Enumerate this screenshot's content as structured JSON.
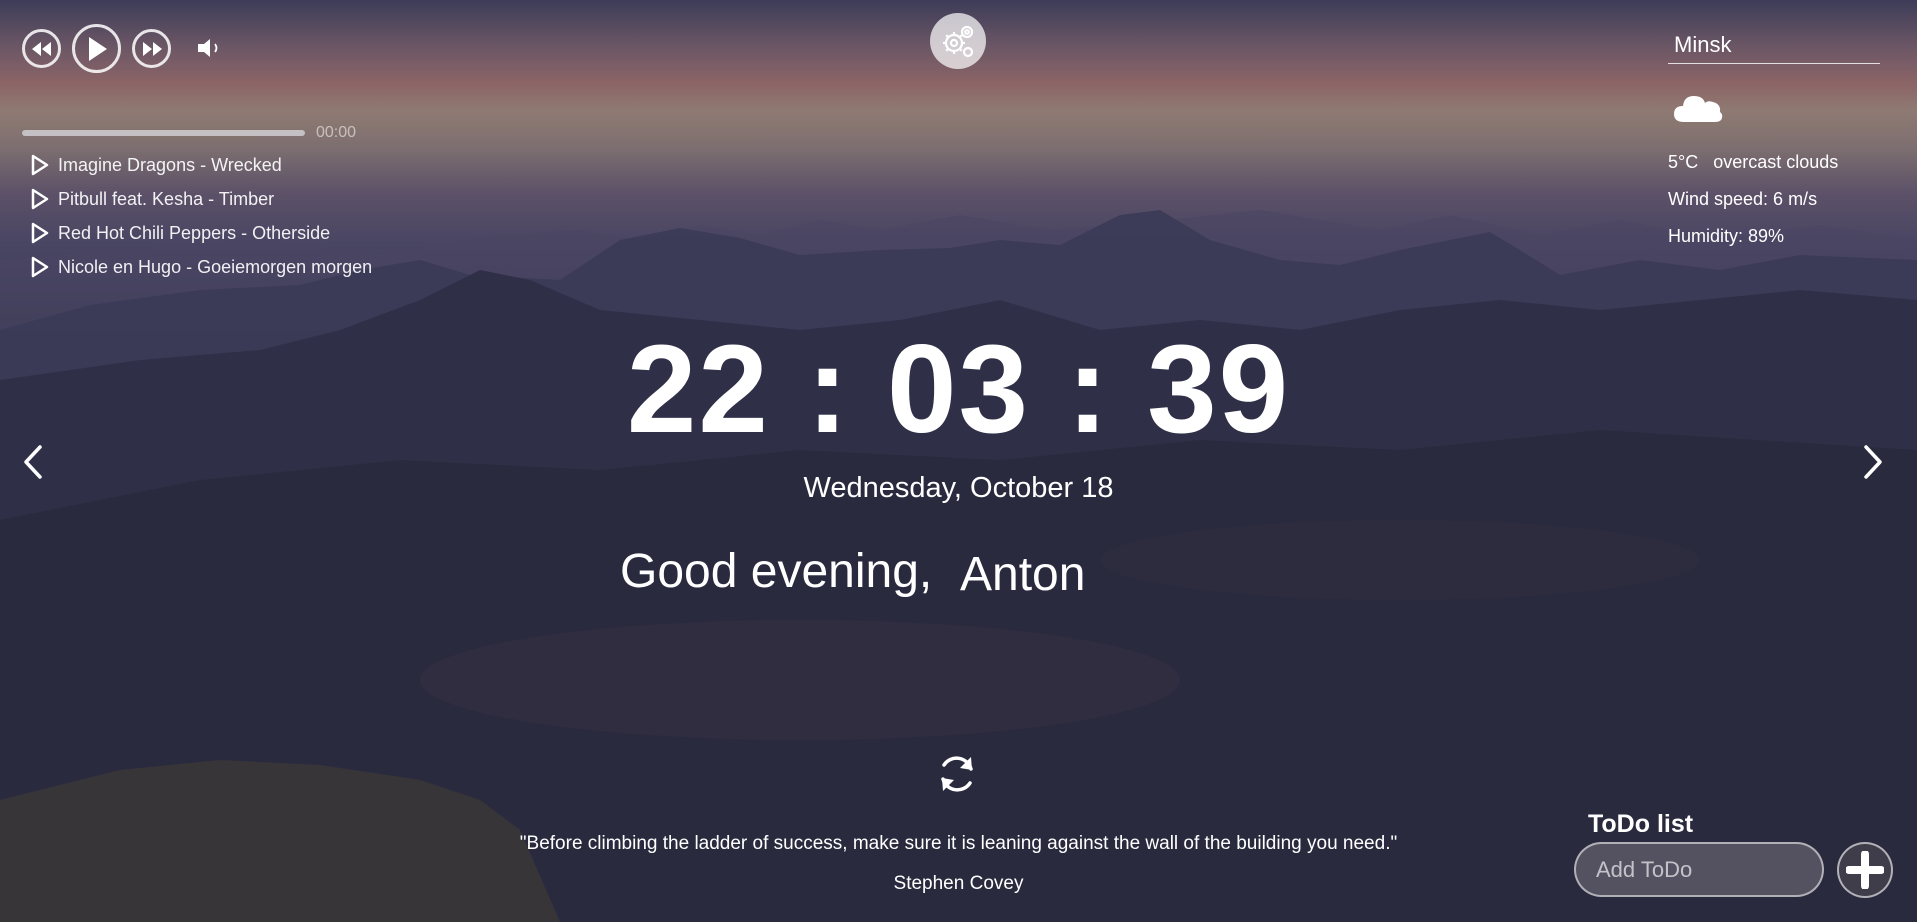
{
  "player": {
    "prev_icon": "rewind-icon",
    "play_icon": "play-icon",
    "next_icon": "fast-forward-icon",
    "volume_icon": "volume-icon",
    "current_time": "00:00",
    "progress_fraction": 0,
    "playlist": [
      {
        "title": "Imagine Dragons - Wrecked"
      },
      {
        "title": "Pitbull feat. Kesha - Timber"
      },
      {
        "title": "Red Hot Chili Peppers - Otherside"
      },
      {
        "title": "Nicole en Hugo - Goeiemorgen morgen"
      }
    ]
  },
  "settings": {
    "icon": "gears-icon"
  },
  "weather": {
    "city": "Minsk",
    "icon": "cloud-icon",
    "temperature": "5°C",
    "description": "overcast clouds",
    "wind": "Wind speed: 6 m/s",
    "humidity": "Humidity: 89%"
  },
  "slider": {
    "prev_icon": "chevron-left-icon",
    "next_icon": "chevron-right-icon"
  },
  "clock": {
    "time": "22 : 03 : 39",
    "date": "Wednesday, October 18"
  },
  "greeting": {
    "text": "Good evening,",
    "name": "Anton"
  },
  "quote": {
    "refresh_icon": "refresh-icon",
    "text": "\"Before climbing the ladder of success, make sure it is leaning against the wall of the building you need.\"",
    "author": "Stephen Covey"
  },
  "todo": {
    "title": "ToDo list",
    "placeholder": "Add ToDo",
    "add_icon": "plus-icon"
  },
  "colors": {
    "text": "#ffffff",
    "sky_glow": "#8b6466",
    "mountains": "#2f3048"
  }
}
